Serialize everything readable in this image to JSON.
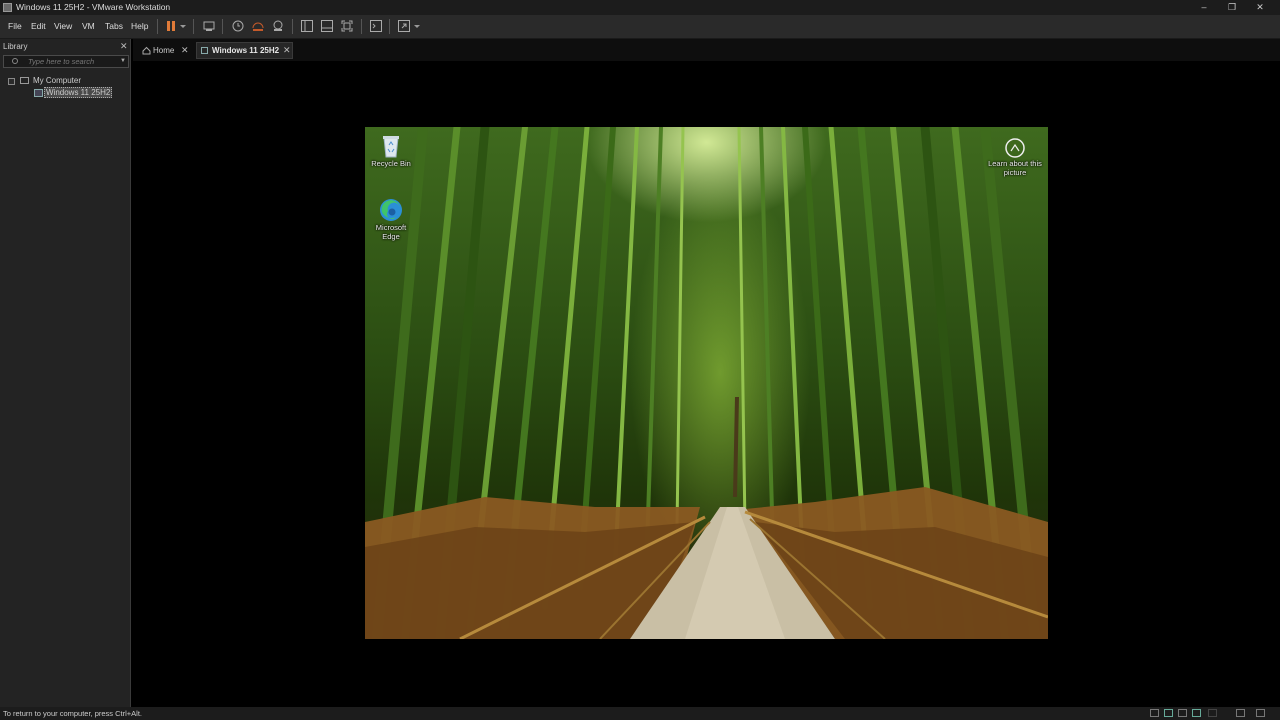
{
  "window": {
    "title": "Windows 11 25H2 - VMware Workstation",
    "controls": {
      "minimize": "–",
      "restore": "❐",
      "close": "✕"
    }
  },
  "menu": [
    "File",
    "Edit",
    "View",
    "VM",
    "Tabs",
    "Help"
  ],
  "toolbar": {
    "icons": [
      "pause-icon",
      "dropdown-arrow-icon",
      "send-ctrl-alt-del-icon",
      "snapshot-icon",
      "revert-snapshot-icon",
      "snapshot-manager-icon",
      "library-view-icon",
      "thumbnail-bar-icon",
      "fullscreen-icon",
      "console-view-icon",
      "stretch-guest-icon",
      "dropdown-arrow-icon"
    ],
    "accent_color": "#e07b39"
  },
  "library": {
    "title": "Library",
    "close": "✕",
    "search_placeholder": "Type here to search",
    "tree": {
      "root": "My Computer",
      "toggle": "−",
      "children": [
        "Windows 11 25H2"
      ],
      "selected": "Windows 11 25H2"
    }
  },
  "tabs": [
    {
      "label": "Home",
      "close": "✕",
      "active": false
    },
    {
      "label": "Windows 11 25H2",
      "close": "✕",
      "active": true
    }
  ],
  "vm": {
    "desktop_icons": [
      {
        "label": "Recycle Bin",
        "icon": "recycle-bin-icon"
      },
      {
        "label": "Microsoft Edge",
        "icon": "edge-icon"
      }
    ],
    "learn_about": {
      "label": "Learn about this picture",
      "icon": "camera-lens-icon"
    },
    "wallpaper": "bamboo-forest-path"
  },
  "statusbar": {
    "message": "To return to your computer, press Ctrl+Alt.",
    "devices": [
      "hard-disk-icon",
      "network-icon",
      "usb-icon",
      "sound-icon",
      "printer-icon",
      "display-icon",
      "message-icon"
    ]
  }
}
